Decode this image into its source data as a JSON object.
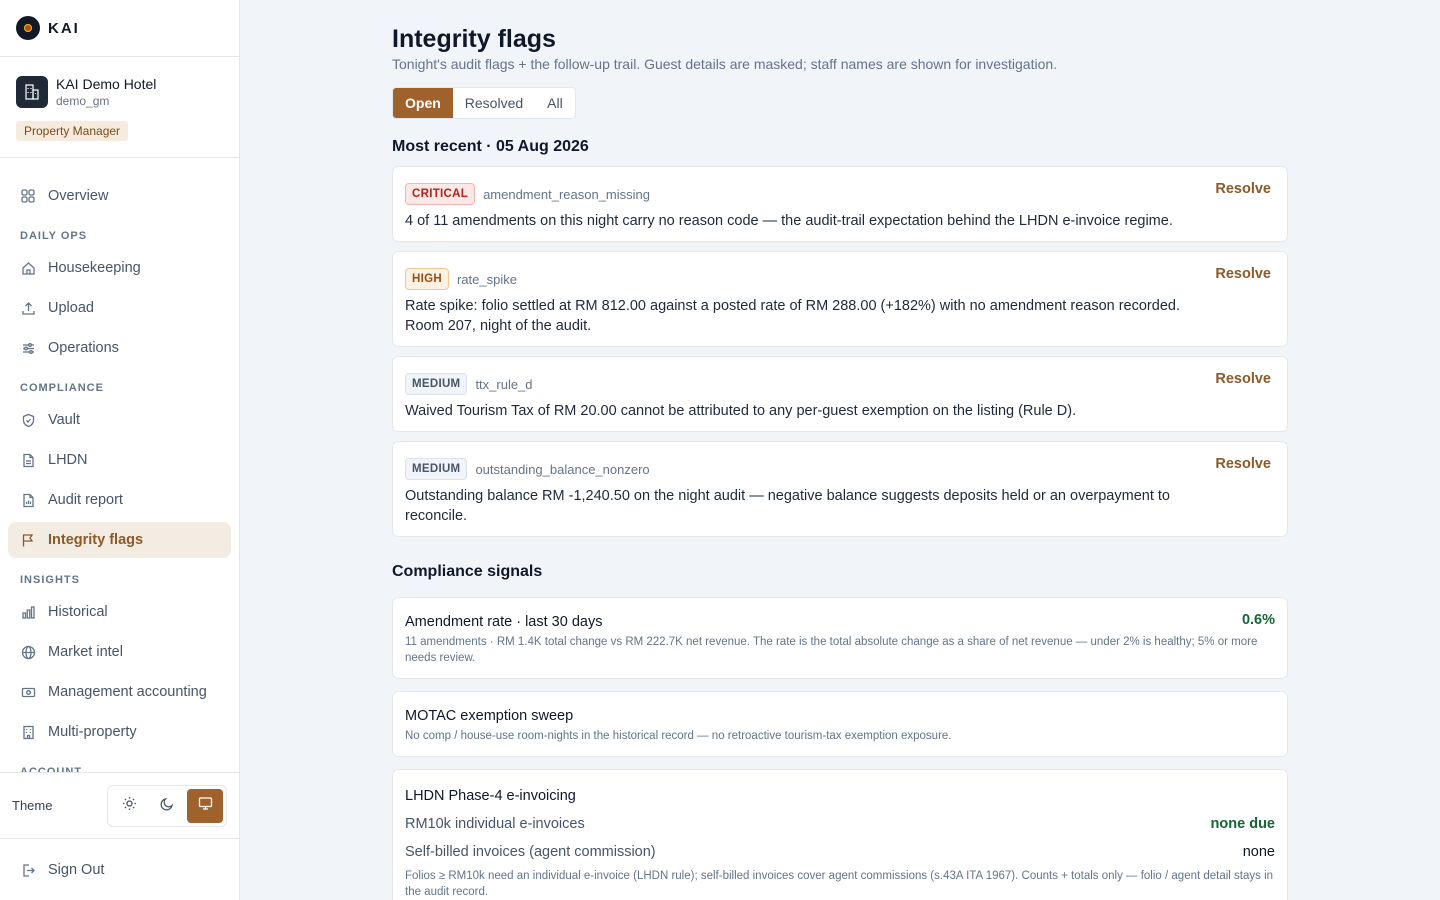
{
  "brand": {
    "name": "KAI"
  },
  "hotel": {
    "name": "KAI Demo Hotel",
    "user": "demo_gm",
    "role": "Property Manager"
  },
  "nav": {
    "overview": "Overview",
    "section_daily": "DAILY OPS",
    "housekeeping": "Housekeeping",
    "upload": "Upload",
    "operations": "Operations",
    "section_compliance": "COMPLIANCE",
    "vault": "Vault",
    "lhdn": "LHDN",
    "audit_report": "Audit report",
    "integrity_flags": "Integrity flags",
    "section_insights": "INSIGHTS",
    "historical": "Historical",
    "market_intel": "Market intel",
    "management_accounting": "Management accounting",
    "multi_property": "Multi-property",
    "section_account": "ACCOUNT"
  },
  "theme": {
    "label": "Theme",
    "selected": "system"
  },
  "signout": "Sign Out",
  "page": {
    "title": "Integrity flags",
    "subtitle": "Tonight's audit flags + the follow-up trail. Guest details are masked; staff names are shown for investigation."
  },
  "filters": {
    "open": "Open",
    "resolved": "Resolved",
    "all": "All",
    "selected": "Open"
  },
  "recent": {
    "title": "Most recent · 05 Aug 2026",
    "resolve_label": "Resolve",
    "flags": [
      {
        "severity": "CRITICAL",
        "code": "amendment_reason_missing",
        "text": "4 of 11 amendments on this night carry no reason code — the audit-trail expectation behind the LHDN e-invoice regime."
      },
      {
        "severity": "HIGH",
        "code": "rate_spike",
        "text": "Rate spike: folio settled at RM 812.00 against a posted rate of RM 288.00 (+182%) with no amendment reason recorded. Room 207, night of the audit."
      },
      {
        "severity": "MEDIUM",
        "code": "ttx_rule_d",
        "text": "Waived Tourism Tax of RM 20.00 cannot be attributed to any per-guest exemption on the listing (Rule D)."
      },
      {
        "severity": "MEDIUM",
        "code": "outstanding_balance_nonzero",
        "text": "Outstanding balance RM -1,240.50 on the night audit — negative balance suggests deposits held or an overpayment to reconcile."
      }
    ]
  },
  "signals": {
    "title": "Compliance signals",
    "amendment": {
      "title": "Amendment rate · last 30 days",
      "value": "0.6%",
      "note": "11 amendments · RM 1.4K total change vs RM 222.7K net revenue. The rate is the total absolute change as a share of net revenue — under 2% is healthy; 5% or more needs review."
    },
    "motac": {
      "title": "MOTAC exemption sweep",
      "note": "No comp / house-use room-nights in the historical record — no retroactive tourism-tax exemption exposure."
    },
    "lhdn": {
      "title": "LHDN Phase-4 e-invoicing",
      "row1_label": "RM10k individual e-invoices",
      "row1_value": "none due",
      "row2_label": "Self-billed invoices (agent commission)",
      "row2_value": "none",
      "note": "Folios ≥ RM10k need an individual e-invoice (LHDN rule); self-billed invoices cover agent commissions (s.43A ITA 1967). Counts + totals only — folio / agent detail stays in the audit record."
    }
  }
}
